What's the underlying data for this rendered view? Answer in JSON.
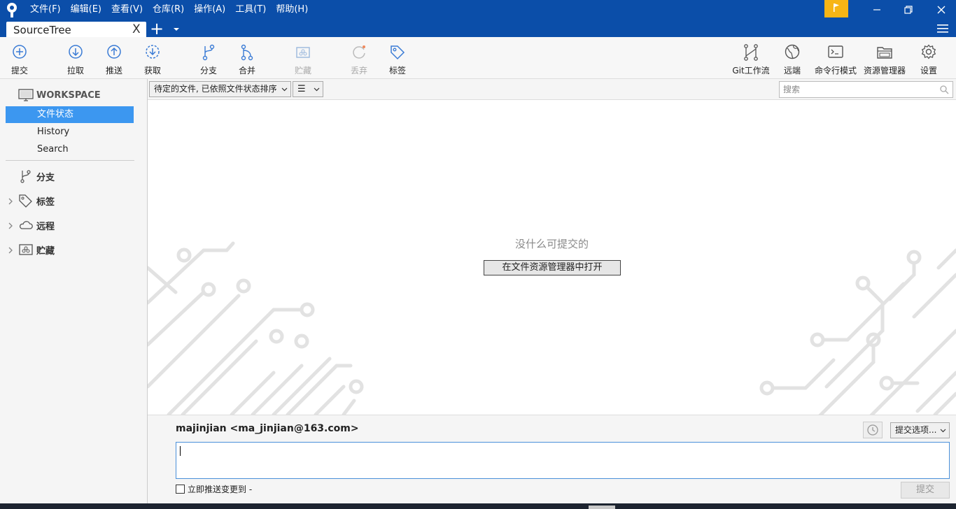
{
  "menu": [
    "文件(F)",
    "编辑(E)",
    "查看(V)",
    "仓库(R)",
    "操作(A)",
    "工具(T)",
    "帮助(H)"
  ],
  "tab": {
    "title": "SourceTree",
    "close": "X",
    "new": "+"
  },
  "toolbar": {
    "commit": "提交",
    "pull": "拉取",
    "push": "推送",
    "fetch": "获取",
    "branch": "分支",
    "merge": "合并",
    "stash": "贮藏",
    "discard": "丢弃",
    "tag": "标签",
    "git_flow": "Git工作流",
    "remote": "远端",
    "terminal": "命令行模式",
    "explorer": "资源管理器",
    "settings": "设置"
  },
  "sidebar": {
    "workspace": "WORKSPACE",
    "items": [
      "文件状态",
      "History",
      "Search"
    ],
    "sections": [
      "分支",
      "标签",
      "远程",
      "贮藏"
    ]
  },
  "filter": {
    "sort": "待定的文件, 已依照文件状态排序",
    "view_icon": "☰",
    "search_placeholder": "搜索"
  },
  "main": {
    "empty_message": "没什么可提交的",
    "open_explorer": "在文件资源管理器中打开"
  },
  "commit": {
    "author": "majinjian <ma_jinjian@163.com>",
    "options": "提交选项...",
    "push_now": "立即推送变更到 -",
    "commit_button": "提交"
  },
  "colors": {
    "brand": "#0b4ea9",
    "accent": "#3c97f0",
    "flag": "#f7b515"
  }
}
